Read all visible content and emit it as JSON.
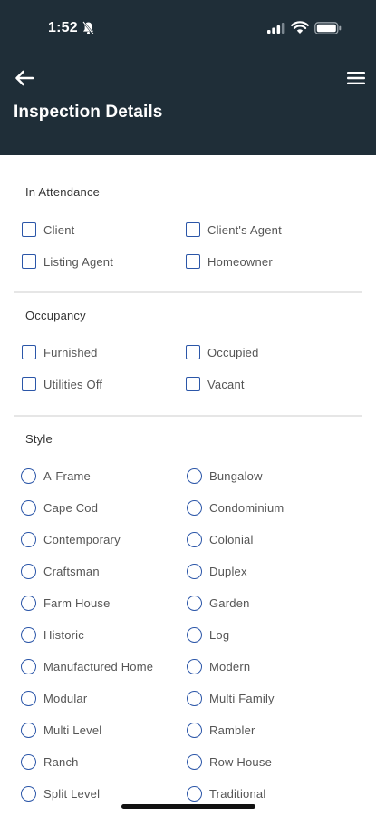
{
  "status_bar": {
    "time": "1:52"
  },
  "header": {
    "title": "Inspection Details"
  },
  "sections": {
    "attendance": {
      "title": "In Attendance",
      "options": [
        "Client",
        "Client's Agent",
        "Listing Agent",
        "Homeowner"
      ]
    },
    "occupancy": {
      "title": "Occupancy",
      "options": [
        "Furnished",
        "Occupied",
        "Utilities Off",
        "Vacant"
      ]
    },
    "style": {
      "title": "Style",
      "options": [
        "A-Frame",
        "Bungalow",
        "Cape Cod",
        "Condominium",
        "Contemporary",
        "Colonial",
        "Craftsman",
        "Duplex",
        "Farm House",
        "Garden",
        "Historic",
        "Log",
        "Manufactured Home",
        "Modern",
        "Modular",
        "Multi Family",
        "Multi Level",
        "Rambler",
        "Ranch",
        "Row House",
        "Split Level",
        "Traditional"
      ]
    }
  },
  "colors": {
    "header_bg": "#1f2e38",
    "accent": "#2b56a8",
    "divider": "#e6e6e6"
  },
  "icons": {
    "back": "arrow-left-icon",
    "menu": "hamburger-menu-icon",
    "bell": "bell-slash-icon",
    "signal": "signal-icon",
    "wifi": "wifi-icon",
    "battery": "battery-icon"
  }
}
